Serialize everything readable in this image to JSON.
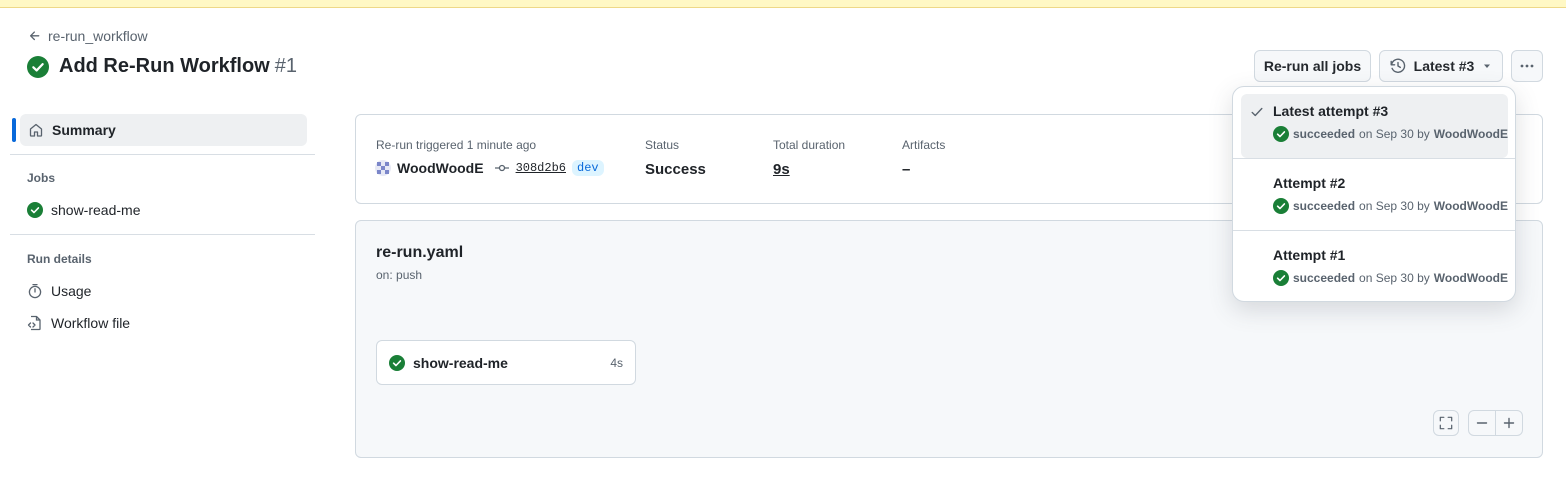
{
  "header": {
    "back_label": "re-run_workflow",
    "title": "Add Re-Run Workflow",
    "run_number": "#1",
    "rerun_all_label": "Re-run all jobs",
    "attempt_selector_label": "Latest #3"
  },
  "sidebar": {
    "summary_label": "Summary",
    "jobs_heading": "Jobs",
    "jobs": [
      {
        "name": "show-read-me"
      }
    ],
    "run_details_heading": "Run details",
    "usage_label": "Usage",
    "workflow_file_label": "Workflow file"
  },
  "summary": {
    "trigger_text": "Re-run triggered 1 minute ago",
    "actor": "WoodWoodE",
    "commit_sha": "308d2b6",
    "branch": "dev",
    "status_label": "Status",
    "status_value": "Success",
    "duration_label": "Total duration",
    "duration_value": "9s",
    "artifacts_label": "Artifacts",
    "artifacts_value": "–"
  },
  "workflow": {
    "file_name": "re-run.yaml",
    "trigger": "on: push",
    "job_name": "show-read-me",
    "job_duration": "4s"
  },
  "attempts_menu": [
    {
      "title": "Latest attempt #3",
      "result": "succeeded",
      "date_text": "on Sep 30 by",
      "actor": "WoodWoodE",
      "selected": true
    },
    {
      "title": "Attempt #2",
      "result": "succeeded",
      "date_text": "on Sep 30 by",
      "actor": "WoodWoodE",
      "selected": false
    },
    {
      "title": "Attempt #1",
      "result": "succeeded",
      "date_text": "on Sep 30 by",
      "actor": "WoodWoodE",
      "selected": false
    }
  ],
  "colors": {
    "success": "#1a7f37",
    "accent": "#0969da",
    "banner": "#fff8c5"
  },
  "icons": {
    "back": "arrow-left-icon",
    "status": "check-circle-fill-icon",
    "history": "history-icon",
    "more": "kebab-horizontal-icon",
    "home": "home-icon",
    "usage": "stopwatch-icon",
    "workflow_file": "file-code-icon",
    "commit": "git-commit-icon",
    "fullscreen": "screen-full-icon",
    "zoom_out": "minus-icon",
    "zoom_in": "plus-icon"
  }
}
